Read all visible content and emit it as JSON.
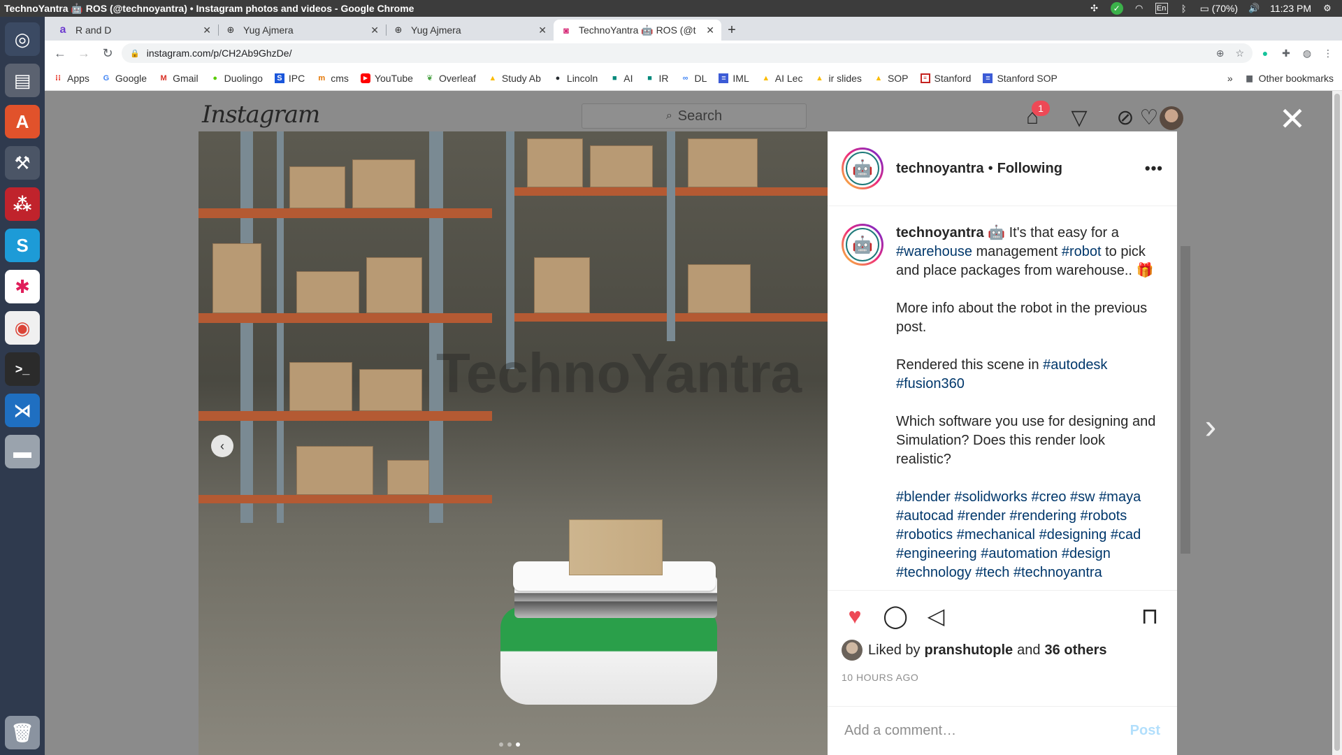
{
  "topbar": {
    "window_title": "TechnoYantra 🤖 ROS (@technoyantra) • Instagram photos and videos - Google Chrome",
    "battery": "(70%)",
    "time": "11:23 PM",
    "lang": "En"
  },
  "tabs": [
    {
      "label": "R and D",
      "icon": "a-icon"
    },
    {
      "label": "Yug Ajmera",
      "icon": "globe-icon"
    },
    {
      "label": "Yug Ajmera",
      "icon": "globe-icon"
    },
    {
      "label": "TechnoYantra 🤖 ROS (@t",
      "icon": "instagram-icon"
    }
  ],
  "address": {
    "url": "instagram.com/p/CH2Ab9GhzDe/"
  },
  "bookmarks": [
    {
      "label": "Apps",
      "color": "#e94235"
    },
    {
      "label": "Google",
      "color": "#4285f4"
    },
    {
      "label": "Gmail",
      "color": "#d93025"
    },
    {
      "label": "Duolingo",
      "color": "#58cc02"
    },
    {
      "label": "IPC",
      "color": "#1a56db"
    },
    {
      "label": "cms",
      "color": "#e37400"
    },
    {
      "label": "YouTube",
      "color": "#ff0000"
    },
    {
      "label": "Overleaf",
      "color": "#47a141"
    },
    {
      "label": "Study Ab",
      "color": "#fbbc04"
    },
    {
      "label": "Lincoln",
      "color": "#24292e"
    },
    {
      "label": "AI",
      "color": "#00897b"
    },
    {
      "label": "IR",
      "color": "#00897b"
    },
    {
      "label": "DL",
      "color": "#4285f4"
    },
    {
      "label": "IML",
      "color": "#3c5bd6"
    },
    {
      "label": "AI Lec",
      "color": "#fbbc04"
    },
    {
      "label": "ir slides",
      "color": "#fbbc04"
    },
    {
      "label": "SOP",
      "color": "#fbbc04"
    },
    {
      "label": "Stanford",
      "color": "#c5221f"
    },
    {
      "label": "Stanford SOP",
      "color": "#3c5bd6"
    }
  ],
  "bookmarks_more": "»",
  "bookmarks_other": "Other bookmarks",
  "instagram": {
    "logo": "Instagram",
    "search_placeholder": "Search",
    "notification_count": "1"
  },
  "post": {
    "username": "technoyantra",
    "dot": "•",
    "follow_state": "Following",
    "more": "•••",
    "caption_user": "technoyantra",
    "caption_lines": [
      [
        "🤖 It's that easy for a ",
        "#warehouse",
        " management ",
        "#robot",
        " to pick and place packages from warehouse.. 🎁"
      ],
      [
        "More info about the robot in the previous post."
      ],
      [
        "Rendered this scene in ",
        "#autodesk",
        " ",
        "#fusion360"
      ],
      [
        "Which software you use for designing and Simulation? Does this render look realistic?"
      ],
      [
        "#blender #solidworks #creo #sw #maya #autocad #render #rendering #robots #robotics #mechanical #designing #cad #engineering #automation #design #technology #tech #technoyantra"
      ]
    ],
    "liked_by_prefix": "Liked by",
    "liked_by_user": "pranshutople",
    "liked_by_and": "and",
    "liked_by_others": "36 others",
    "time_ago": "10 HOURS AGO",
    "comment_placeholder": "Add a comment…",
    "post_label": "Post",
    "image_watermark": "TechnoYantra",
    "carousel_count": 3,
    "carousel_active": 2
  }
}
